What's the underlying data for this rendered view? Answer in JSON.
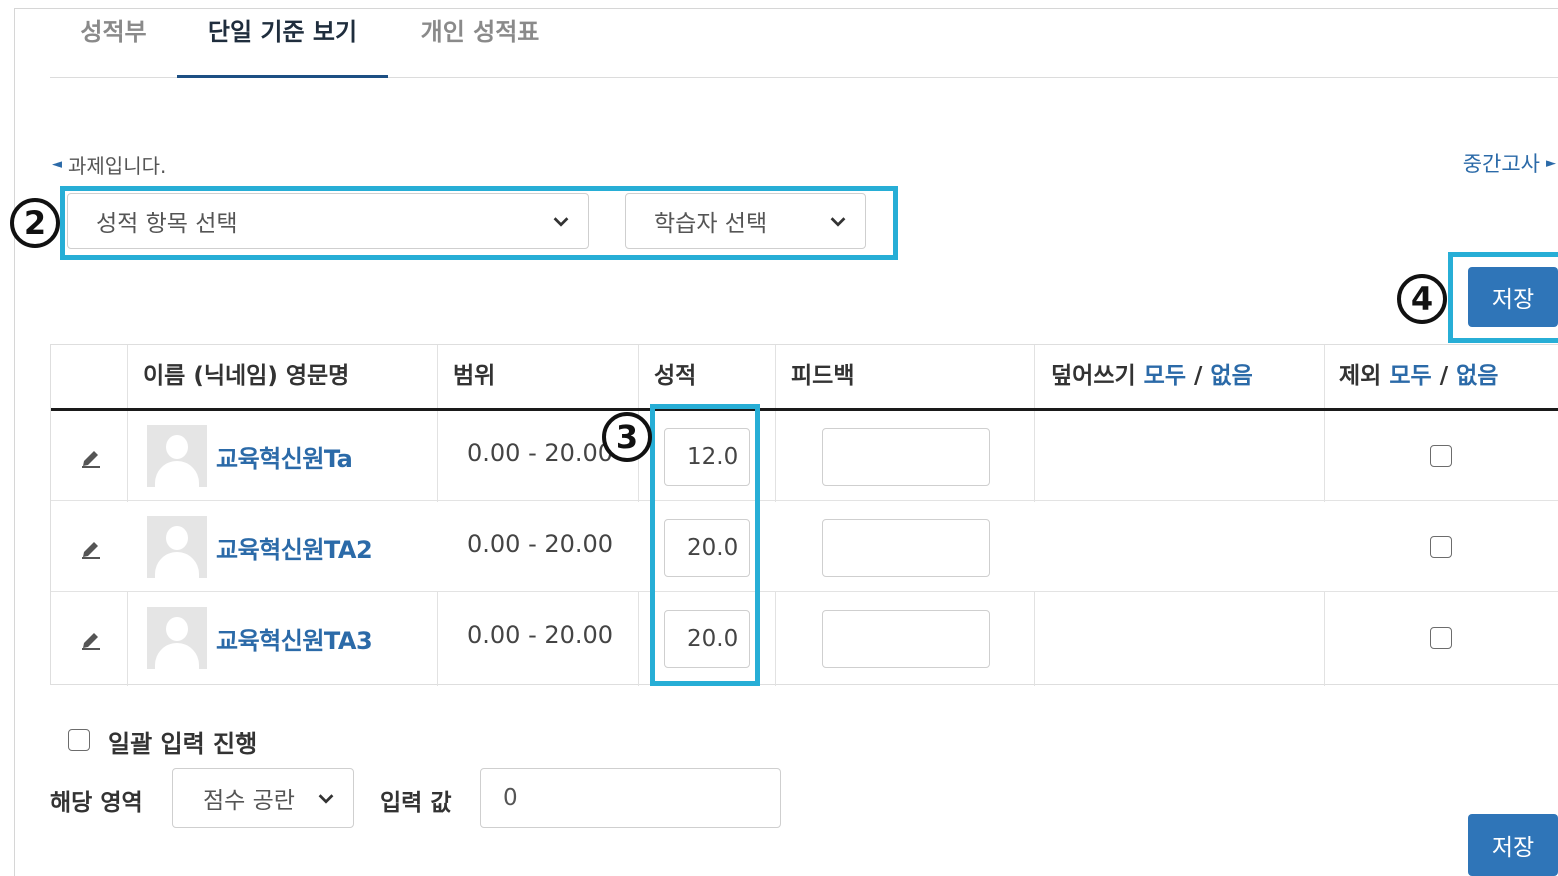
{
  "tabs": [
    "성적부",
    "단일 기준 보기",
    "개인 성적표"
  ],
  "nav": {
    "prev": "과제입니다.",
    "next": "중간고사"
  },
  "selects": {
    "grade_item": "성적 항목 선택",
    "student": "학습자 선택"
  },
  "markers": [
    "2",
    "3",
    "4"
  ],
  "save_label": "저장",
  "table": {
    "col_name": "이름 (닉네임) 영문명",
    "col_range": "범위",
    "col_grade": "성적",
    "col_feedback": "피드백",
    "col_override": "덮어쓰기",
    "col_exclude": "제외",
    "all": "모두",
    "slash": "/",
    "none": "없음",
    "rows": [
      {
        "name": "교육혁신원Ta",
        "range": "0.00 - 20.00",
        "grade": "12.0",
        "feedback": "",
        "excluded": false
      },
      {
        "name": "교육혁신원TA2",
        "range": "0.00 - 20.00",
        "grade": "20.0",
        "feedback": "",
        "excluded": false
      },
      {
        "name": "교육혁신원TA3",
        "range": "0.00 - 20.00",
        "grade": "20.0",
        "feedback": "",
        "excluded": false
      }
    ]
  },
  "bulk": {
    "checkbox_label": "일괄 입력 진행",
    "area_label": "해당 영역",
    "area_value": "점수 공란",
    "value_label": "입력 값",
    "value": "0"
  },
  "colors": {
    "accent": "#2f75b8",
    "highlight": "#27aed6",
    "link": "#2b6aa8"
  }
}
